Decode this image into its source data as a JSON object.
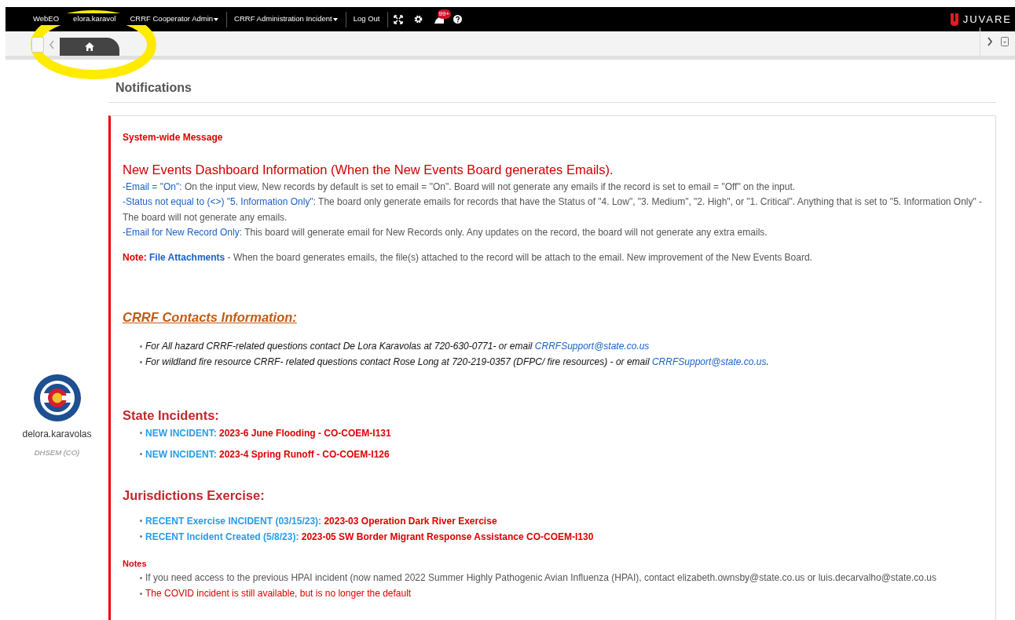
{
  "top_bar": {
    "items": [
      {
        "kind": "text",
        "label": "WebEO"
      },
      {
        "kind": "text",
        "label": "elora.karavol"
      },
      {
        "kind": "menu",
        "label": "CRRF Cooperator Admin"
      },
      {
        "kind": "menu",
        "label": "CRRF Administration Incident"
      },
      {
        "kind": "link",
        "label": "Log Out"
      }
    ],
    "alert_badge": "99+",
    "brand": "JUVARE"
  },
  "tabs": [
    {
      "kind": "home",
      "selected": true
    }
  ],
  "user": {
    "name": "delora.karavolas",
    "organization": "DHSEM (CO)"
  },
  "page_title": "Notifications",
  "message": {
    "label": "System-wide Message",
    "heading": "New Events Dashboard Information (When the New Events Board generates Emails).",
    "paragraphs": [
      [
        {
          "kind": "lead",
          "text": "-Email = \"On\":"
        },
        {
          "kind": "body",
          "text": " On the input view, New records by default is set to email = \"On\". Board will not generate any emails if the record is set to email = \"Off\" on the input."
        }
      ],
      [
        {
          "kind": "lead",
          "text": "-Status not equal to (<>) \"5. Information Only\":"
        },
        {
          "kind": "body",
          "text": " The board only generate emails for records that have the Status of \"4. Low\", \"3. Medium\", \"2. High\", or \"1. Critical\". Anything that is set to \"5. Information Only\" - The board will not generate any emails."
        }
      ],
      [
        {
          "kind": "lead",
          "text": "-Email for New Record Only:"
        },
        {
          "kind": "body",
          "text": " This board will generate email for New Records only. Any updates on the record, the board will not generate any extra emails."
        }
      ]
    ],
    "note": [
      {
        "kind": "note",
        "text": "Note:"
      },
      {
        "kind": "strong",
        "text": " File Attachments"
      },
      {
        "kind": "body",
        "text": " - When the board generates emails, the file(s) attached to the record will be attach to the email. New improvement of the New Events Board."
      }
    ],
    "contacts_heading": "CRRF Contacts Information:",
    "contacts": [
      {
        "text": "For  All hazard CRRF-related questions contact De Lora Karavolas at 720-630-0771- or email ",
        "link": "CRRFSupport@state.co.us"
      },
      {
        "text": "For wildland fire resource CRRF- related questions contact Rose Long at 720-219-0357 (DFPC/ fire resources) - or email ",
        "link": "CRRFSupport@state.co.us",
        "after": "."
      }
    ],
    "state_heading": "State Incidents:",
    "state_incidents": [
      {
        "label": "NEW INCIDENT:",
        "title": "2023-6 June Flooding - CO-COEM-I131"
      },
      {
        "label": "NEW INCIDENT:",
        "title": "2023-4 Spring Runoff - CO-COEM-I126"
      }
    ],
    "exercise_heading": "Jurisdictions Exercise:",
    "exercises": [
      {
        "label": "RECENT Exercise INCIDENT (03/15/23):",
        "title": "2023-03 Operation Dark River Exercise"
      },
      {
        "label": "RECENT Incident Created (5/8/23):",
        "title": "2023-05 SW Border Migrant Response Assistance CO-COEM-I130"
      }
    ],
    "notes_heading": "Notes",
    "notes": [
      {
        "kind": "plain",
        "text": "If you need access to the previous HPAI incident (now named 2022 Summer Highly Pathogenic Avian Influenza (HPAI), contact elizabeth.ownsby@state.co.us or luis.decarvalho@state.co.us"
      },
      {
        "kind": "alert",
        "text": "The COVID incident is still available, but is no longer the default"
      }
    ]
  }
}
